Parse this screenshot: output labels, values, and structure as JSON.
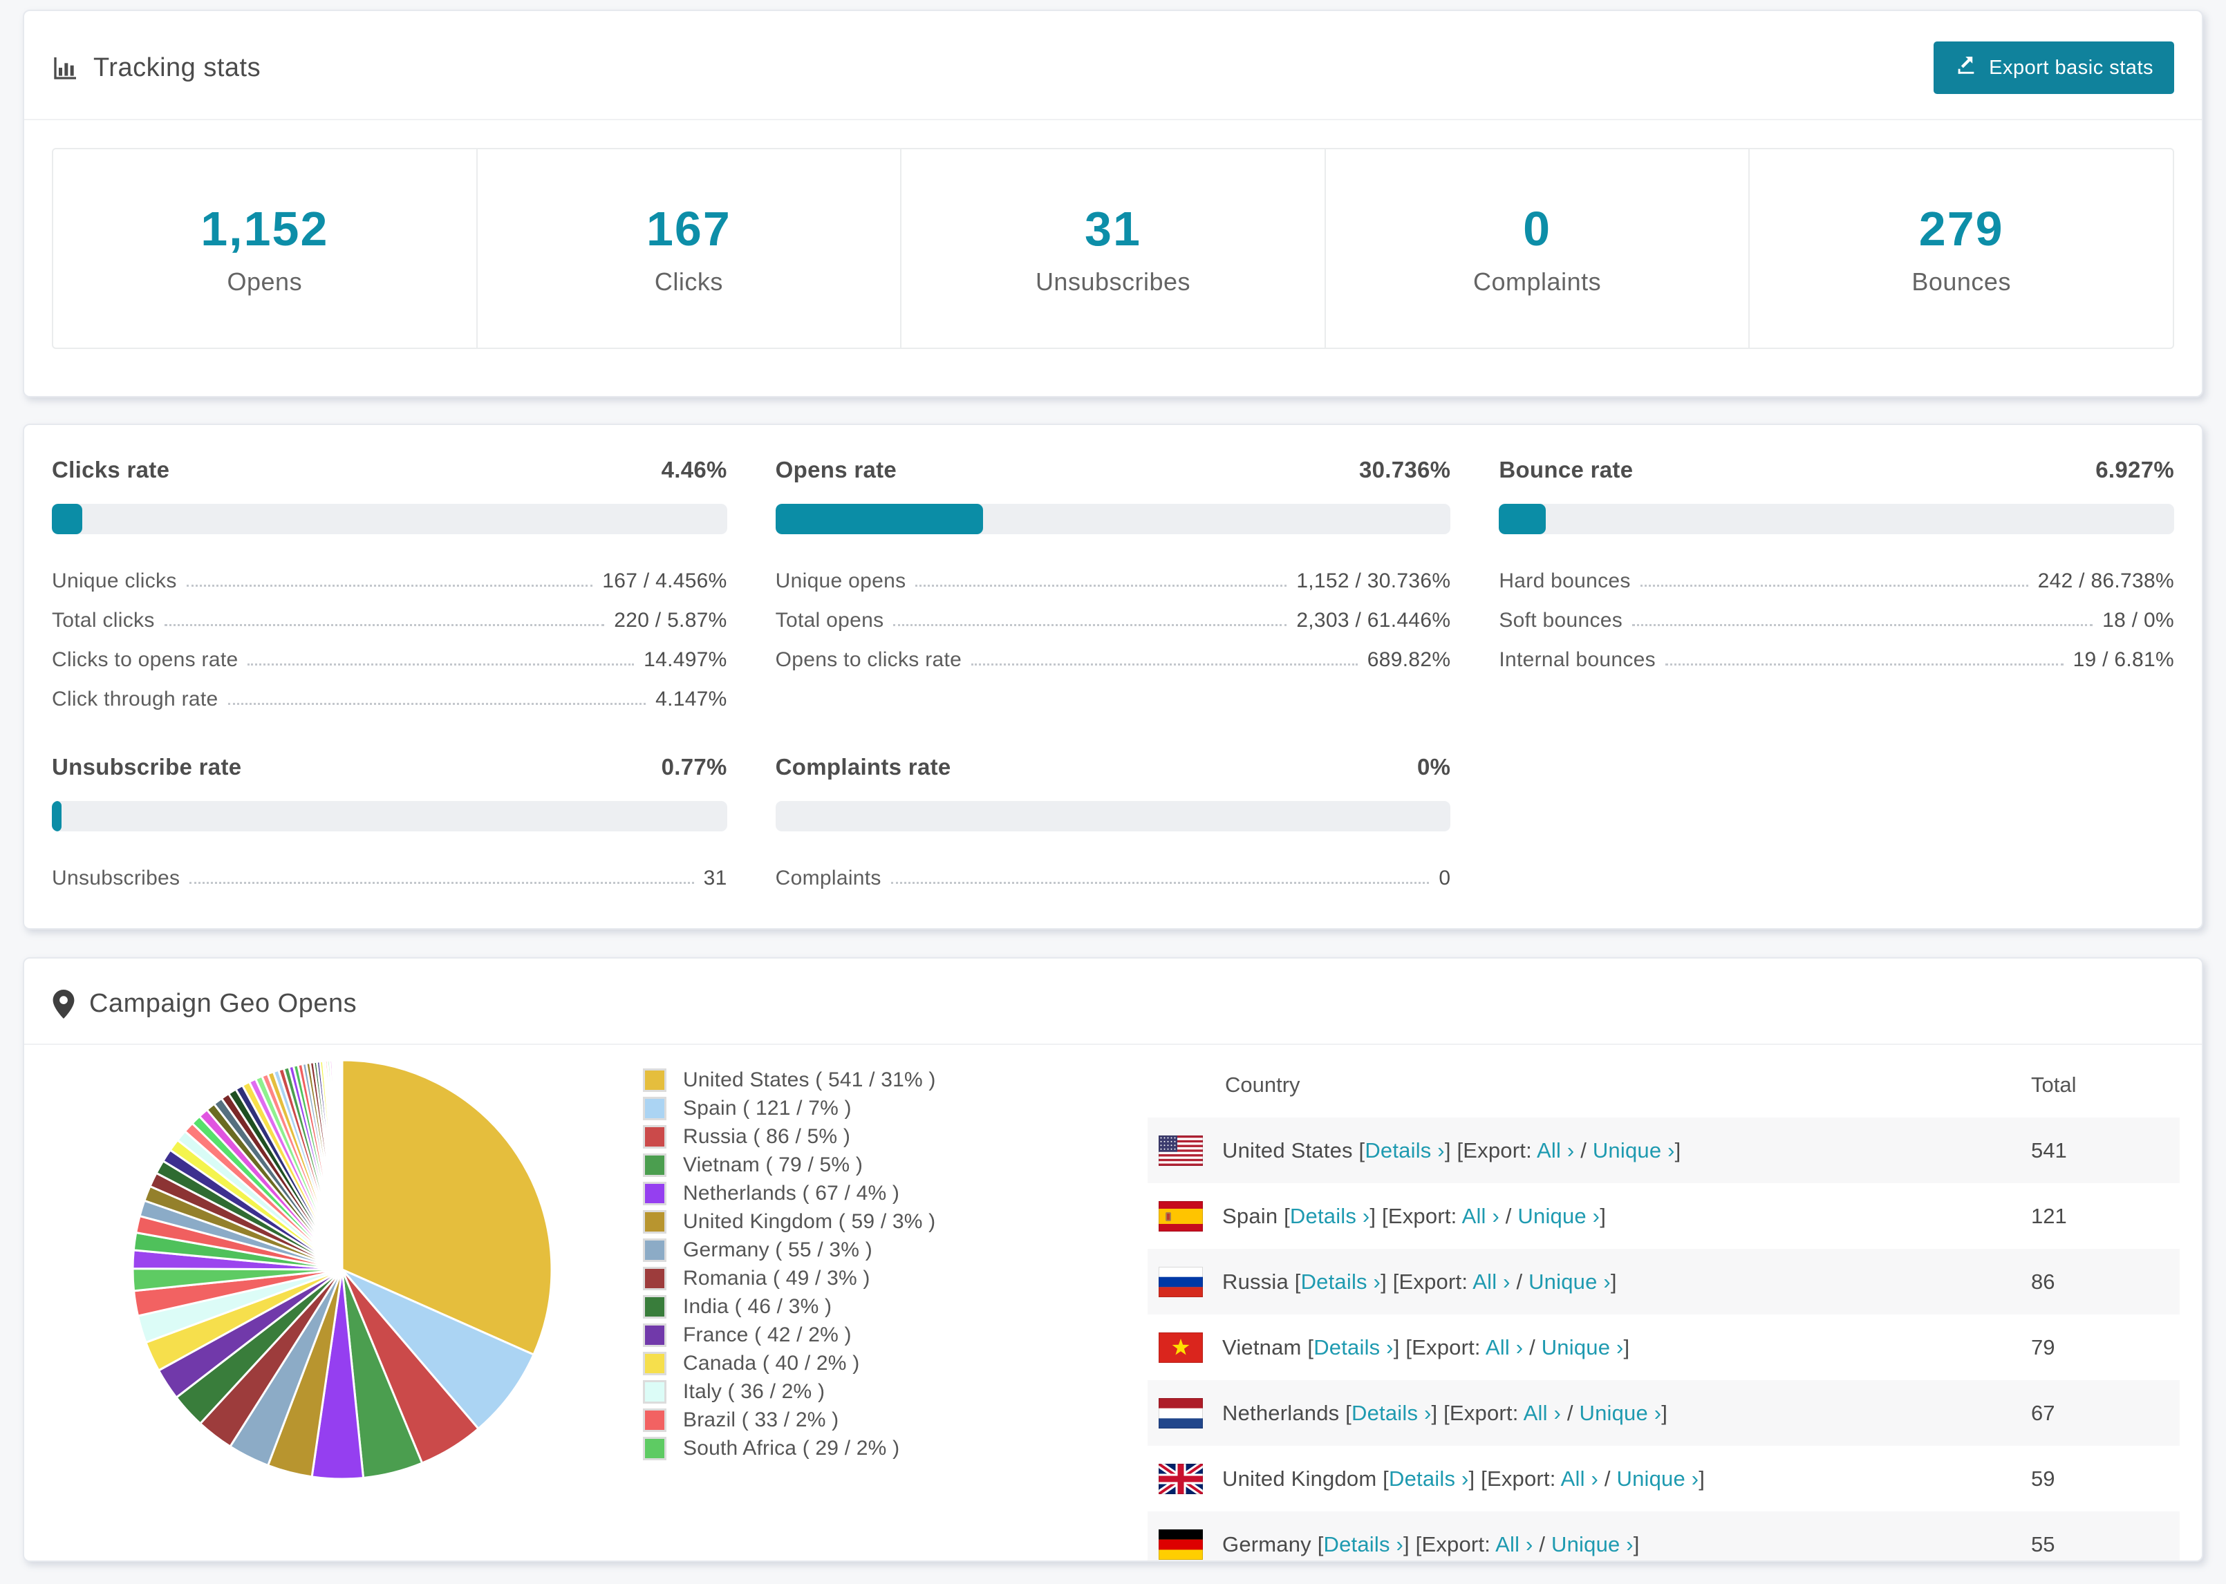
{
  "colors": {
    "accent": "#0d8ea8",
    "button": "#10829c",
    "link": "#1e9ab0",
    "bar_track": "#edeff2"
  },
  "tracking": {
    "title": "Tracking stats",
    "export_button": "Export basic stats",
    "summary": [
      {
        "value": "1,152",
        "label": "Opens"
      },
      {
        "value": "167",
        "label": "Clicks"
      },
      {
        "value": "31",
        "label": "Unsubscribes"
      },
      {
        "value": "0",
        "label": "Complaints"
      },
      {
        "value": "279",
        "label": "Bounces"
      }
    ]
  },
  "rates": {
    "blocks": [
      {
        "title": "Clicks rate",
        "value": "4.46%",
        "percent": 4.46,
        "rows": [
          {
            "label": "Unique clicks",
            "value": "167 / 4.456%"
          },
          {
            "label": "Total clicks",
            "value": "220 / 5.87%"
          },
          {
            "label": "Clicks to opens rate",
            "value": "14.497%"
          },
          {
            "label": "Click through rate",
            "value": "4.147%"
          }
        ]
      },
      {
        "title": "Opens rate",
        "value": "30.736%",
        "percent": 30.736,
        "rows": [
          {
            "label": "Unique opens",
            "value": "1,152 / 30.736%"
          },
          {
            "label": "Total opens",
            "value": "2,303 / 61.446%"
          },
          {
            "label": "Opens to clicks rate",
            "value": "689.82%"
          }
        ]
      },
      {
        "title": "Bounce rate",
        "value": "6.927%",
        "percent": 6.927,
        "rows": [
          {
            "label": "Hard bounces",
            "value": "242 / 86.738%"
          },
          {
            "label": "Soft bounces",
            "value": "18 / 0%"
          },
          {
            "label": "Internal bounces",
            "value": "19 / 6.81%"
          }
        ]
      },
      {
        "title": "Unsubscribe rate",
        "value": "0.77%",
        "percent": 0.77,
        "rows": [
          {
            "label": "Unsubscribes",
            "value": "31"
          }
        ]
      },
      {
        "title": "Complaints rate",
        "value": "0%",
        "percent": 0,
        "rows": [
          {
            "label": "Complaints",
            "value": "0"
          }
        ]
      }
    ]
  },
  "geo": {
    "title": "Campaign Geo Opens",
    "legend": [
      {
        "label": "United States ( 541 / 31% )",
        "color": "#e5be3d"
      },
      {
        "label": "Spain ( 121 / 7% )",
        "color": "#abd4f3"
      },
      {
        "label": "Russia ( 86 / 5% )",
        "color": "#cb4a4a"
      },
      {
        "label": "Vietnam ( 79 / 5% )",
        "color": "#4b9e4f"
      },
      {
        "label": "Netherlands ( 67 / 4% )",
        "color": "#953ff0"
      },
      {
        "label": "United Kingdom ( 59 / 3% )",
        "color": "#b8952f"
      },
      {
        "label": "Germany ( 55 / 3% )",
        "color": "#8cabc6"
      },
      {
        "label": "Romania ( 49 / 3% )",
        "color": "#9d3c3c"
      },
      {
        "label": "India ( 46 / 3% )",
        "color": "#397d3b"
      },
      {
        "label": "France ( 42 / 2% )",
        "color": "#7139aa"
      },
      {
        "label": "Canada ( 40 / 2% )",
        "color": "#f6df4c"
      },
      {
        "label": "Italy ( 36 / 2% )",
        "color": "#dcfcf7"
      },
      {
        "label": "Brazil ( 33 / 2% )",
        "color": "#f26262"
      },
      {
        "label": "South Africa ( 29 / 2% )",
        "color": "#5ecb63"
      }
    ],
    "table": {
      "columns": [
        "Country",
        "Total"
      ],
      "link_labels": {
        "details": "Details ›",
        "export_prefix": "Export:",
        "all": "All ›",
        "unique": "Unique ›"
      },
      "rows": [
        {
          "country": "United States",
          "flag": "us",
          "total": "541"
        },
        {
          "country": "Spain",
          "flag": "es",
          "total": "121"
        },
        {
          "country": "Russia",
          "flag": "ru",
          "total": "86"
        },
        {
          "country": "Vietnam",
          "flag": "vn",
          "total": "79"
        },
        {
          "country": "Netherlands",
          "flag": "nl",
          "total": "67"
        },
        {
          "country": "United Kingdom",
          "flag": "gb",
          "total": "59"
        },
        {
          "country": "Germany",
          "flag": "de",
          "total": "55"
        }
      ]
    },
    "chart_data": {
      "type": "pie",
      "title": "Campaign Geo Opens",
      "legend_position": "right",
      "start_angle_deg": 0,
      "direction": "clockwise",
      "series": [
        {
          "name": "United States",
          "value": 541,
          "pct": "31%",
          "color": "#e5be3d"
        },
        {
          "name": "Spain",
          "value": 121,
          "pct": "7%",
          "color": "#abd4f3"
        },
        {
          "name": "Russia",
          "value": 86,
          "pct": "5%",
          "color": "#cb4a4a"
        },
        {
          "name": "Vietnam",
          "value": 79,
          "pct": "5%",
          "color": "#4b9e4f"
        },
        {
          "name": "Netherlands",
          "value": 67,
          "pct": "4%",
          "color": "#953ff0"
        },
        {
          "name": "United Kingdom",
          "value": 59,
          "pct": "3%",
          "color": "#b8952f"
        },
        {
          "name": "Germany",
          "value": 55,
          "pct": "3%",
          "color": "#8cabc6"
        },
        {
          "name": "Romania",
          "value": 49,
          "pct": "3%",
          "color": "#9d3c3c"
        },
        {
          "name": "India",
          "value": 46,
          "pct": "3%",
          "color": "#397d3b"
        },
        {
          "name": "France",
          "value": 42,
          "pct": "2%",
          "color": "#7139aa"
        },
        {
          "name": "Canada",
          "value": 40,
          "pct": "2%",
          "color": "#f6df4c"
        },
        {
          "name": "Italy",
          "value": 36,
          "pct": "2%",
          "color": "#dcfcf7"
        },
        {
          "name": "Brazil",
          "value": 33,
          "pct": "2%",
          "color": "#f26262"
        },
        {
          "name": "South Africa",
          "value": 29,
          "pct": "2%",
          "color": "#5ecb63"
        }
      ],
      "others_estimated": [
        24,
        23,
        22,
        21,
        20,
        19,
        18,
        17,
        16,
        15,
        14,
        13,
        13,
        12,
        12,
        11,
        11,
        10,
        10,
        9,
        9,
        8,
        8,
        7,
        7,
        7,
        6,
        6,
        6,
        5,
        5,
        5,
        4,
        4,
        4,
        3,
        3,
        3,
        3,
        2,
        2,
        2,
        2,
        1,
        1,
        1,
        1,
        1
      ],
      "others_palette": [
        "#9b44ee",
        "#4fc15b",
        "#f05f5f",
        "#8babc7",
        "#94802b",
        "#8c3434",
        "#2f6b31",
        "#3d2f8f",
        "#f4f44e",
        "#d9fcf6",
        "#fd7a7a",
        "#57e06b",
        "#e055e0",
        "#6b6b22",
        "#55707f",
        "#7a2828",
        "#1f4f22",
        "#30307a",
        "#f7e04b",
        "#e06bf0",
        "#8ef08e",
        "#ff8585",
        "#e5be3d",
        "#abd4f3",
        "#cb4a4a",
        "#4b9e4f"
      ]
    }
  }
}
